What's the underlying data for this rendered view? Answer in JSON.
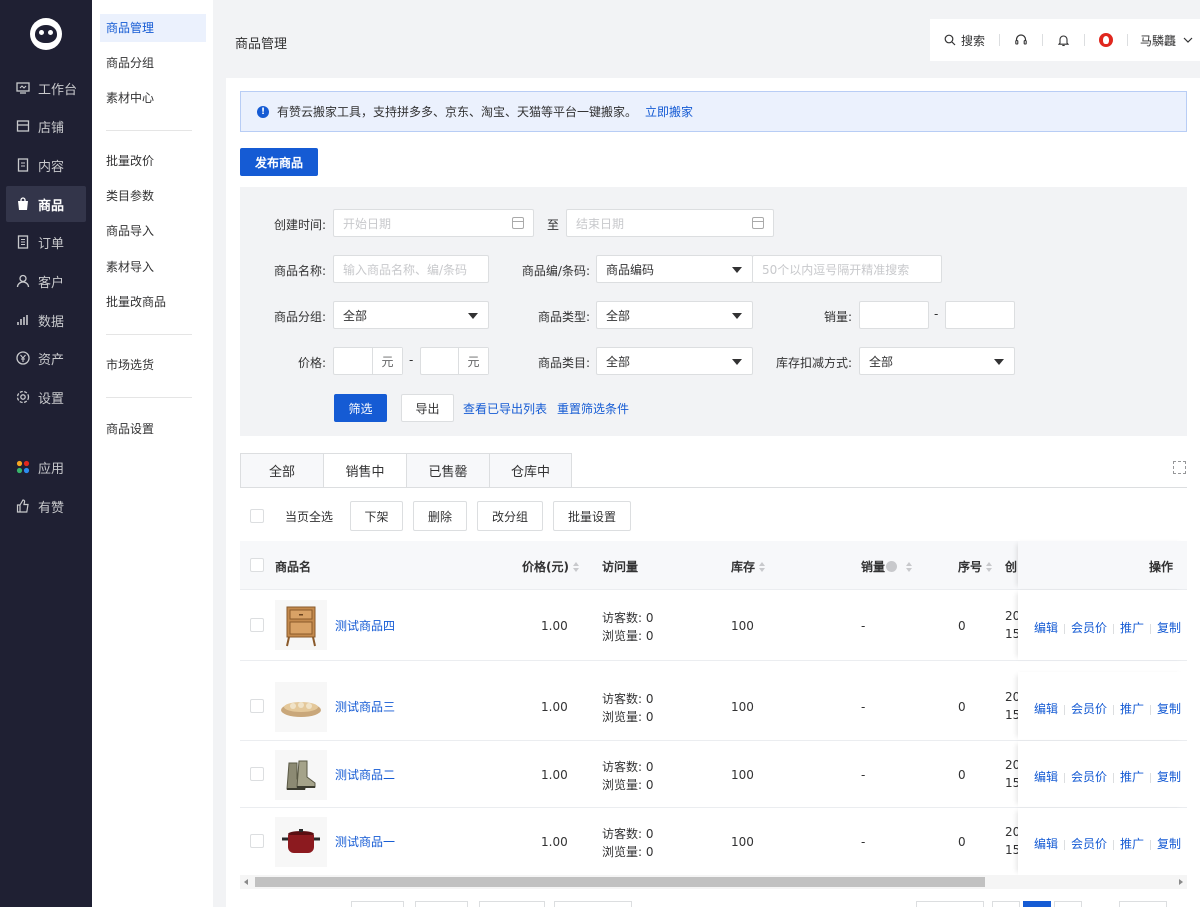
{
  "nav": {
    "items": [
      {
        "label": "工作台",
        "icon": "monitor-icon"
      },
      {
        "label": "店铺",
        "icon": "store-icon"
      },
      {
        "label": "内容",
        "icon": "document-icon"
      },
      {
        "label": "商品",
        "icon": "bag-icon",
        "active": true
      },
      {
        "label": "订单",
        "icon": "list-icon"
      },
      {
        "label": "客户",
        "icon": "user-icon"
      },
      {
        "label": "数据",
        "icon": "bar-chart-icon"
      },
      {
        "label": "资产",
        "icon": "yen-icon"
      },
      {
        "label": "设置",
        "icon": "gear-icon"
      },
      {
        "label": "应用",
        "icon": "apps-icon"
      },
      {
        "label": "有赞",
        "icon": "thumb-up-icon"
      }
    ]
  },
  "submenu": {
    "items": [
      "商品管理",
      "商品分组",
      "素材中心",
      "批量改价",
      "类目参数",
      "商品导入",
      "素材导入",
      "批量改商品",
      "市场选货",
      "商品设置"
    ]
  },
  "header": {
    "breadcrumb": "商品管理",
    "search_label": "搜索",
    "user_name": "马驎龘"
  },
  "notice": {
    "text": "有赞云搬家工具，支持拼多多、京东、淘宝、天猫等平台一键搬家。",
    "link": "立即搬家"
  },
  "publish_button": "发布商品",
  "filter": {
    "created_label": "创建时间:",
    "start_placeholder": "开始日期",
    "to": "至",
    "end_placeholder": "结束日期",
    "name_label": "商品名称:",
    "name_placeholder": "输入商品名称、编/条码",
    "code_label": "商品编/条码:",
    "code_select": "商品编码",
    "code_placeholder": "50个以内逗号隔开精准搜索",
    "group_label": "商品分组:",
    "group_value": "全部",
    "type_label": "商品类型:",
    "type_value": "全部",
    "sales_label": "销量:",
    "price_label": "价格:",
    "unit": "元",
    "dash": "-",
    "category_label": "商品类目:",
    "category_value": "全部",
    "stock_method_label": "库存扣减方式:",
    "stock_method_value": "全部",
    "filter_button": "筛选",
    "export_button": "导出",
    "view_exports_link": "查看已导出列表",
    "reset_link": "重置筛选条件"
  },
  "tabs": [
    "全部",
    "销售中",
    "已售罄",
    "仓库中"
  ],
  "active_tab": "销售中",
  "bulk": {
    "select_all": "当页全选",
    "buttons": [
      "下架",
      "删除",
      "改分组",
      "批量设置"
    ]
  },
  "table": {
    "columns": {
      "name": "商品名",
      "price": "价格(元)",
      "visits": "访问量",
      "stock": "库存",
      "sales": "销量",
      "seq": "序号",
      "created": "创",
      "actions": "操作"
    },
    "rows": [
      {
        "name": "测试商品四",
        "price": "1.00",
        "visitors": "访客数: 0",
        "views": "浏览量: 0",
        "stock": "100",
        "sales": "-",
        "seq": "0",
        "created_1": "20",
        "created_2": "15",
        "thumb": "wooden-cabinet-icon"
      },
      {
        "name": "测试商品三",
        "price": "1.00",
        "visitors": "访客数: 0",
        "views": "浏览量: 0",
        "stock": "100",
        "sales": "-",
        "seq": "0",
        "created_1": "20",
        "created_2": "15",
        "thumb": "bread-tray-icon"
      },
      {
        "name": "测试商品二",
        "price": "1.00",
        "visitors": "访客数: 0",
        "views": "浏览量: 0",
        "stock": "100",
        "sales": "-",
        "seq": "0",
        "created_1": "20",
        "created_2": "15",
        "thumb": "boots-icon"
      },
      {
        "name": "测试商品一",
        "price": "1.00",
        "visitors": "访客数: 0",
        "views": "浏览量: 0",
        "stock": "100",
        "sales": "-",
        "seq": "0",
        "created_1": "20",
        "created_2": "15",
        "thumb": "red-pot-icon"
      }
    ],
    "actions": [
      "编辑",
      "会员价",
      "推广",
      "复制"
    ]
  },
  "colors": {
    "primary": "#155bd4",
    "nav_bg": "#1f2033"
  }
}
